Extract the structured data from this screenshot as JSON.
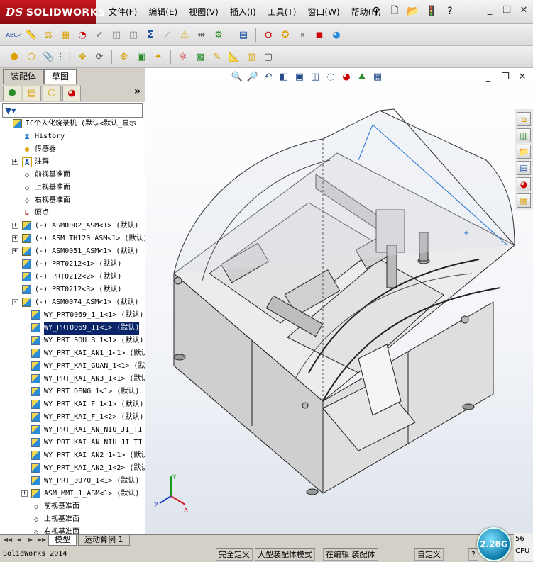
{
  "app": {
    "brand_prefix": "DS",
    "brand_name": "SOLIDWORKS"
  },
  "menu": [
    "文件(F)",
    "编辑(E)",
    "视图(V)",
    "插入(I)",
    "工具(T)",
    "窗口(W)",
    "帮助(H)"
  ],
  "left_panel": {
    "tabs": [
      "装配体",
      "草图"
    ],
    "active_tab": 0,
    "filter_icon": "funnel-icon",
    "collapse_glyph": "»"
  },
  "tree": [
    {
      "label": "IC个人化烧录机 (默认<默认_显示",
      "icon": "assembly",
      "indent": 0,
      "expand": ""
    },
    {
      "label": "History",
      "icon": "history",
      "indent": 1,
      "expand": ""
    },
    {
      "label": "传感器",
      "icon": "sensor",
      "indent": 1,
      "expand": ""
    },
    {
      "label": "注解",
      "icon": "annotation",
      "indent": 1,
      "expand": "+"
    },
    {
      "label": "前视基准面",
      "icon": "plane",
      "indent": 1,
      "expand": ""
    },
    {
      "label": "上视基准面",
      "icon": "plane",
      "indent": 1,
      "expand": ""
    },
    {
      "label": "右视基准面",
      "icon": "plane",
      "indent": 1,
      "expand": ""
    },
    {
      "label": "原点",
      "icon": "origin",
      "indent": 1,
      "expand": ""
    },
    {
      "label": "(-) ASM0002_ASM<1> (默认)",
      "icon": "assembly",
      "indent": 1,
      "expand": "+"
    },
    {
      "label": "(-) ASM_TH120_ASM<1> (默认)",
      "icon": "assembly",
      "indent": 1,
      "expand": "+"
    },
    {
      "label": "(-) ASM0051_ASM<1> (默认)",
      "icon": "assembly",
      "indent": 1,
      "expand": "+"
    },
    {
      "label": "(-) PRT0212<1> (默认)",
      "icon": "part",
      "indent": 1,
      "expand": ""
    },
    {
      "label": "(-) PRT0212<2> (默认)",
      "icon": "part",
      "indent": 1,
      "expand": ""
    },
    {
      "label": "(-) PRT0212<3> (默认)",
      "icon": "part",
      "indent": 1,
      "expand": ""
    },
    {
      "label": "(-) ASM0074_ASM<1> (默认)",
      "icon": "assembly",
      "indent": 1,
      "expand": "-"
    },
    {
      "label": "WY_PRT0069_1_1<1> (默认)",
      "icon": "part",
      "indent": 2,
      "expand": ""
    },
    {
      "label": "WY_PRT0069_11<1> (默认)",
      "icon": "part",
      "indent": 2,
      "expand": "",
      "selected": true
    },
    {
      "label": "WY_PRT_SOU_B_1<1> (默认)",
      "icon": "part",
      "indent": 2,
      "expand": ""
    },
    {
      "label": "WY_PRT_KAI_AN1_1<1> (默认",
      "icon": "part",
      "indent": 2,
      "expand": ""
    },
    {
      "label": "WY_PRT_KAI_GUAN_1<1> (默",
      "icon": "part",
      "indent": 2,
      "expand": ""
    },
    {
      "label": "WY_PRT_KAI_AN3_1<1> (默认",
      "icon": "part",
      "indent": 2,
      "expand": ""
    },
    {
      "label": "WY_PRT_DENG_1<1> (默认)",
      "icon": "part",
      "indent": 2,
      "expand": ""
    },
    {
      "label": "WY_PRT_KAI_F_1<1> (默认)",
      "icon": "part",
      "indent": 2,
      "expand": ""
    },
    {
      "label": "WY_PRT_KAI_F_1<2> (默认)",
      "icon": "part",
      "indent": 2,
      "expand": ""
    },
    {
      "label": "WY_PRT_KAI_AN_NIU_JI_TI",
      "icon": "part",
      "indent": 2,
      "expand": ""
    },
    {
      "label": "WY_PRT_KAI_AN_NIU_JI_TI",
      "icon": "part",
      "indent": 2,
      "expand": ""
    },
    {
      "label": "WY_PRT_KAI_AN2_1<1> (默认",
      "icon": "part",
      "indent": 2,
      "expand": ""
    },
    {
      "label": "WY_PRT_KAI_AN2_1<2> (默认",
      "icon": "part",
      "indent": 2,
      "expand": ""
    },
    {
      "label": "WY_PRT_0070_1<1> (默认)",
      "icon": "part",
      "indent": 2,
      "expand": ""
    },
    {
      "label": "ASM_MMI_1_ASM<1> (默认)",
      "icon": "assembly",
      "indent": 2,
      "expand": "+"
    },
    {
      "label": "前视基准面",
      "icon": "plane",
      "indent": 2,
      "expand": ""
    },
    {
      "label": "上视基准面",
      "icon": "plane",
      "indent": 2,
      "expand": ""
    },
    {
      "label": "右视基准面",
      "icon": "plane",
      "indent": 2,
      "expand": ""
    }
  ],
  "bottom_tabs": [
    "模型",
    "运动算例 1"
  ],
  "status": {
    "app_version": "SolidWorks 2014",
    "definition": "完全定义",
    "mode": "大型装配体模式",
    "editing": "在编辑 装配体",
    "units": "自定义",
    "help_glyph": "?"
  },
  "overlay": {
    "gauge_value": "2.28G",
    "cpu_top": "56",
    "cpu_label": "CPU"
  },
  "triad": {
    "x": "X",
    "y": "Y",
    "z": "Z"
  },
  "colors": {
    "brand_red": "#c8161d",
    "selection": "#0a246a",
    "sheet_metal": "#c8c8c8"
  }
}
